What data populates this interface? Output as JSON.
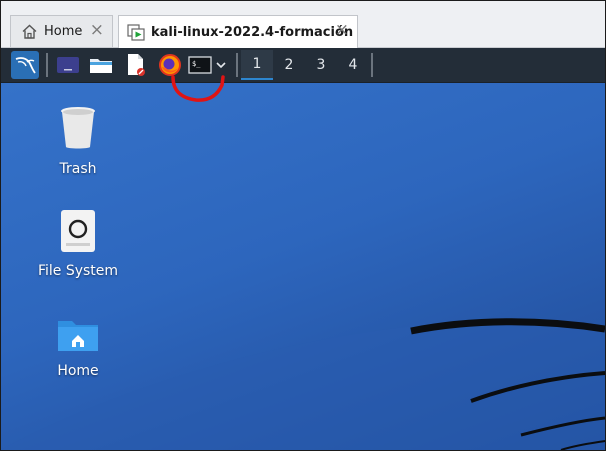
{
  "tabs": [
    {
      "label": "Home",
      "icon": "home-icon"
    },
    {
      "label": "kali-linux-2022.4-formación",
      "icon": "vm-icon"
    }
  ],
  "panel": {
    "workspaces": [
      "1",
      "2",
      "3",
      "4"
    ],
    "active_workspace": "1",
    "launchers": [
      "kali-menu-icon",
      "show-desktop-icon",
      "file-manager-icon",
      "text-editor-icon",
      "firefox-icon",
      "terminal-icon",
      "chevron-down-icon"
    ]
  },
  "desktop": {
    "icons": [
      {
        "label": "Trash",
        "icon": "trash-icon"
      },
      {
        "label": "File System",
        "icon": "drive-icon"
      },
      {
        "label": "Home",
        "icon": "home-folder-icon"
      }
    ]
  },
  "colors": {
    "panel_bg": "#232d38",
    "desktop_blue": "#2d66bd",
    "workspace_accent": "#2d86cf",
    "annotation_red": "#e01414"
  }
}
